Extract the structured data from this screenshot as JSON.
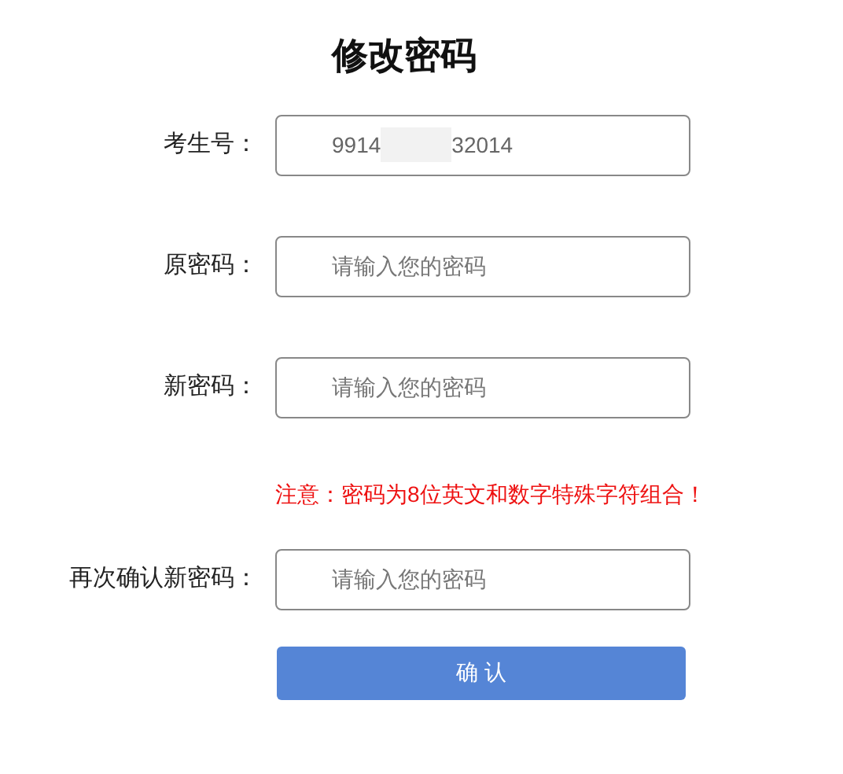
{
  "title": "修改密码",
  "fields": [
    {
      "label": "考生号：",
      "value_parts": [
        "9914",
        "32014"
      ],
      "redacted": true
    },
    {
      "label": "原密码：",
      "placeholder": "请输入您的密码"
    },
    {
      "label": "新密码：",
      "placeholder": "请输入您的密码"
    },
    {
      "label": "再次确认新密码：",
      "placeholder": "请输入您的密码"
    }
  ],
  "notice": "注意：密码为8位英文和数字特殊字符组合！",
  "submit_button": "确 认"
}
